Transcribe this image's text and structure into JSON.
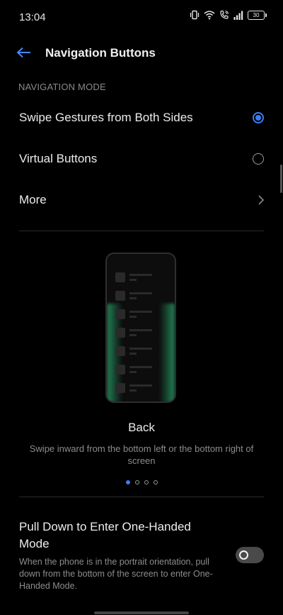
{
  "status_bar": {
    "time": "13:04",
    "battery": "30",
    "icons": [
      "vibrate-icon",
      "wifi-icon",
      "wifi-call-icon",
      "signal-icon",
      "battery-icon"
    ]
  },
  "app_bar": {
    "title": "Navigation Buttons",
    "back_icon": "arrow-left-icon"
  },
  "navigation_mode": {
    "header": "NAVIGATION MODE",
    "options": [
      {
        "label": "Swipe Gestures from Both Sides",
        "selected": true
      },
      {
        "label": "Virtual Buttons",
        "selected": false
      }
    ],
    "more_label": "More"
  },
  "gesture_preview": {
    "title": "Back",
    "description": "Swipe inward from the bottom left or the bottom right of screen",
    "page_count": 4,
    "active_page": 1
  },
  "one_handed": {
    "title": "Pull Down to Enter One-Handed Mode",
    "description": "When the phone is in the portrait orientation, pull down from the bottom of the screen to enter One-Handed Mode.",
    "enabled": false
  },
  "colors": {
    "accent": "#3d7cf5",
    "background": "#000000",
    "glow": "#28aa6e"
  }
}
